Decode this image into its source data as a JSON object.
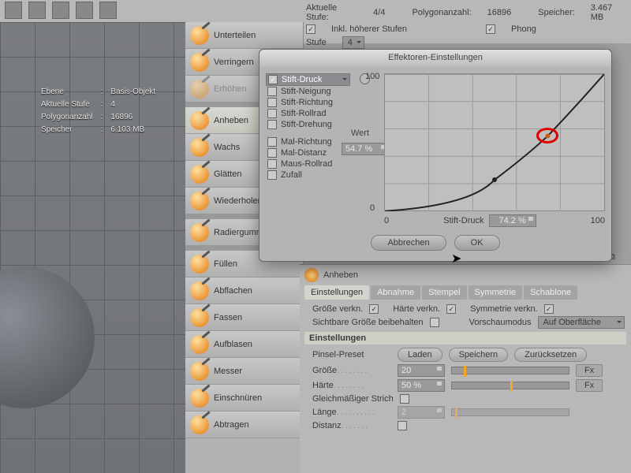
{
  "status": {
    "stufe_label": "Aktuelle Stufe:",
    "stufe_value": "4/4",
    "poly_label": "Polygonanzahl:",
    "poly_value": "16896",
    "mem_label": "Speicher:",
    "mem_value": "3.467 MB",
    "inkl": "Inkl. höherer Stufen",
    "phong": "Phong",
    "stufe2_label": "Stufe",
    "stufe2_value": "4"
  },
  "hud": {
    "r0a": "Ebene",
    "r0b": "Basis-Objekt",
    "r1a": "Aktuelle Stufe",
    "r1b": "4",
    "r2a": "Polygonanzahl",
    "r2b": "16896",
    "r3a": "Speicher",
    "r3b": "6.103 MB"
  },
  "tools": [
    {
      "label": "Unterteilen"
    },
    {
      "label": "Verringern"
    },
    {
      "label": "Erhöhen",
      "dim": true
    },
    {
      "sep": true
    },
    {
      "label": "Anheben",
      "active": true
    },
    {
      "label": "Wachs"
    },
    {
      "label": "Glätten"
    },
    {
      "label": "Wiederholen"
    },
    {
      "sep": true
    },
    {
      "label": "Radiergummi"
    },
    {
      "sep": true
    },
    {
      "label": "Füllen"
    },
    {
      "label": "Abflachen"
    },
    {
      "label": "Fassen"
    },
    {
      "label": "Aufblasen"
    },
    {
      "label": "Messer"
    },
    {
      "label": "Einschnüren"
    },
    {
      "label": "Abtragen"
    }
  ],
  "dialog": {
    "title": "Effektoren-Einstellungen",
    "effectors": [
      "Stift-Druck",
      "Stift-Neigung",
      "Stift-Richtung",
      "Stift-Rollrad",
      "Stift-Drehung",
      "Mal-Richtung",
      "Mal-Distanz",
      "Maus-Rollrad",
      "Zufall"
    ],
    "selected": 0,
    "y_top": "100",
    "y_bot": "0",
    "x_left": "0",
    "x_right": "100",
    "wert_label": "Wert",
    "wert_value": "54.7 %",
    "x_label": "Stift-Druck",
    "x_value": "74.2 %",
    "cancel": "Abbrechen",
    "ok": "OK"
  },
  "attr": {
    "header": "Anheben",
    "tabs": [
      "Einstellungen",
      "Abnahme",
      "Stempel",
      "Symmetrie",
      "Schablone"
    ],
    "active_tab": 0,
    "size_link": "Größe verkn.",
    "hard_link": "Härte verkn.",
    "sym_link": "Symmetrie verkn.",
    "keep_vis": "Sichtbare Größe beibehalten",
    "preview_label": "Vorschaumodus",
    "preview_value": "Auf Oberfläche",
    "section": "Einstellungen",
    "preset": "Pinsel-Preset",
    "load": "Laden",
    "save": "Speichern",
    "reset": "Zurücksetzen",
    "size": "Größe",
    "size_val": "20",
    "hard": "Härte",
    "hard_val": "50 %",
    "even": "Gleichmäßiger Strich",
    "len": "Länge",
    "len_val": "2",
    "dist": "Distanz",
    "fx": "Fx"
  },
  "chart_data": {
    "type": "line",
    "title": "Effektoren-Einstellungen",
    "xlabel": "Stift-Druck",
    "ylabel": "Wert",
    "xlim": [
      0,
      100
    ],
    "ylim": [
      0,
      100
    ],
    "x": [
      0,
      20,
      40,
      50,
      60,
      74.2,
      85,
      100
    ],
    "y": [
      0,
      5,
      15,
      23,
      35,
      54.7,
      72,
      100
    ],
    "control_points": [
      {
        "x": 50,
        "y": 23
      },
      {
        "x": 74.2,
        "y": 54.7
      }
    ],
    "highlight": {
      "x": 74.2,
      "y": 54.7
    }
  }
}
